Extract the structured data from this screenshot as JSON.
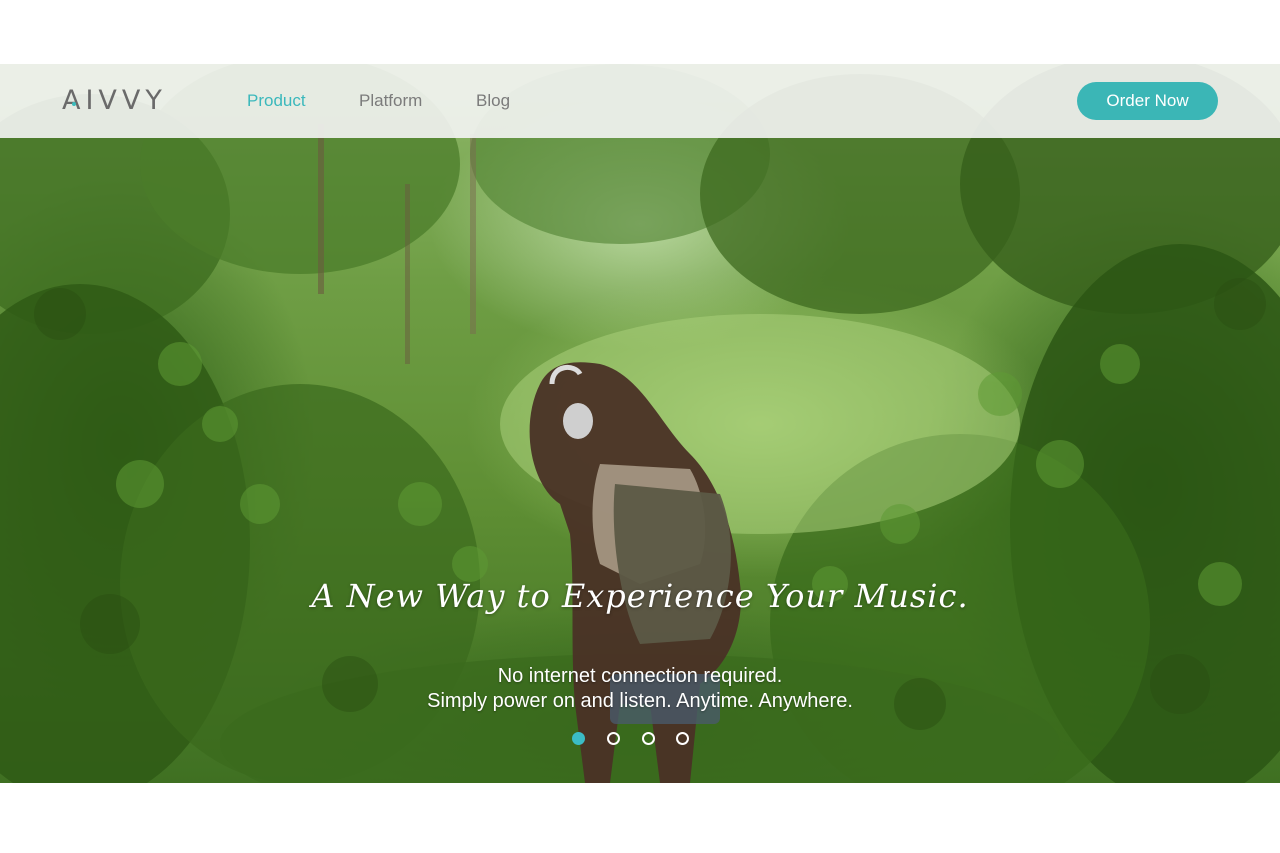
{
  "brand": {
    "name": "AIVVY",
    "accent_color": "#3bb8bc"
  },
  "nav": {
    "items": [
      {
        "label": "Product",
        "active": true
      },
      {
        "label": "Platform",
        "active": false
      },
      {
        "label": "Blog",
        "active": false
      }
    ],
    "cta_label": "Order Now"
  },
  "hero": {
    "headline": "A New Way to Experience Your Music.",
    "subline_1": "No internet connection required.",
    "subline_2": "Simply power on and listen. Anytime. Anywhere.",
    "image_description_icon": "forest-woman-headphones-photo",
    "carousel": {
      "count": 4,
      "active_index": 0
    }
  }
}
